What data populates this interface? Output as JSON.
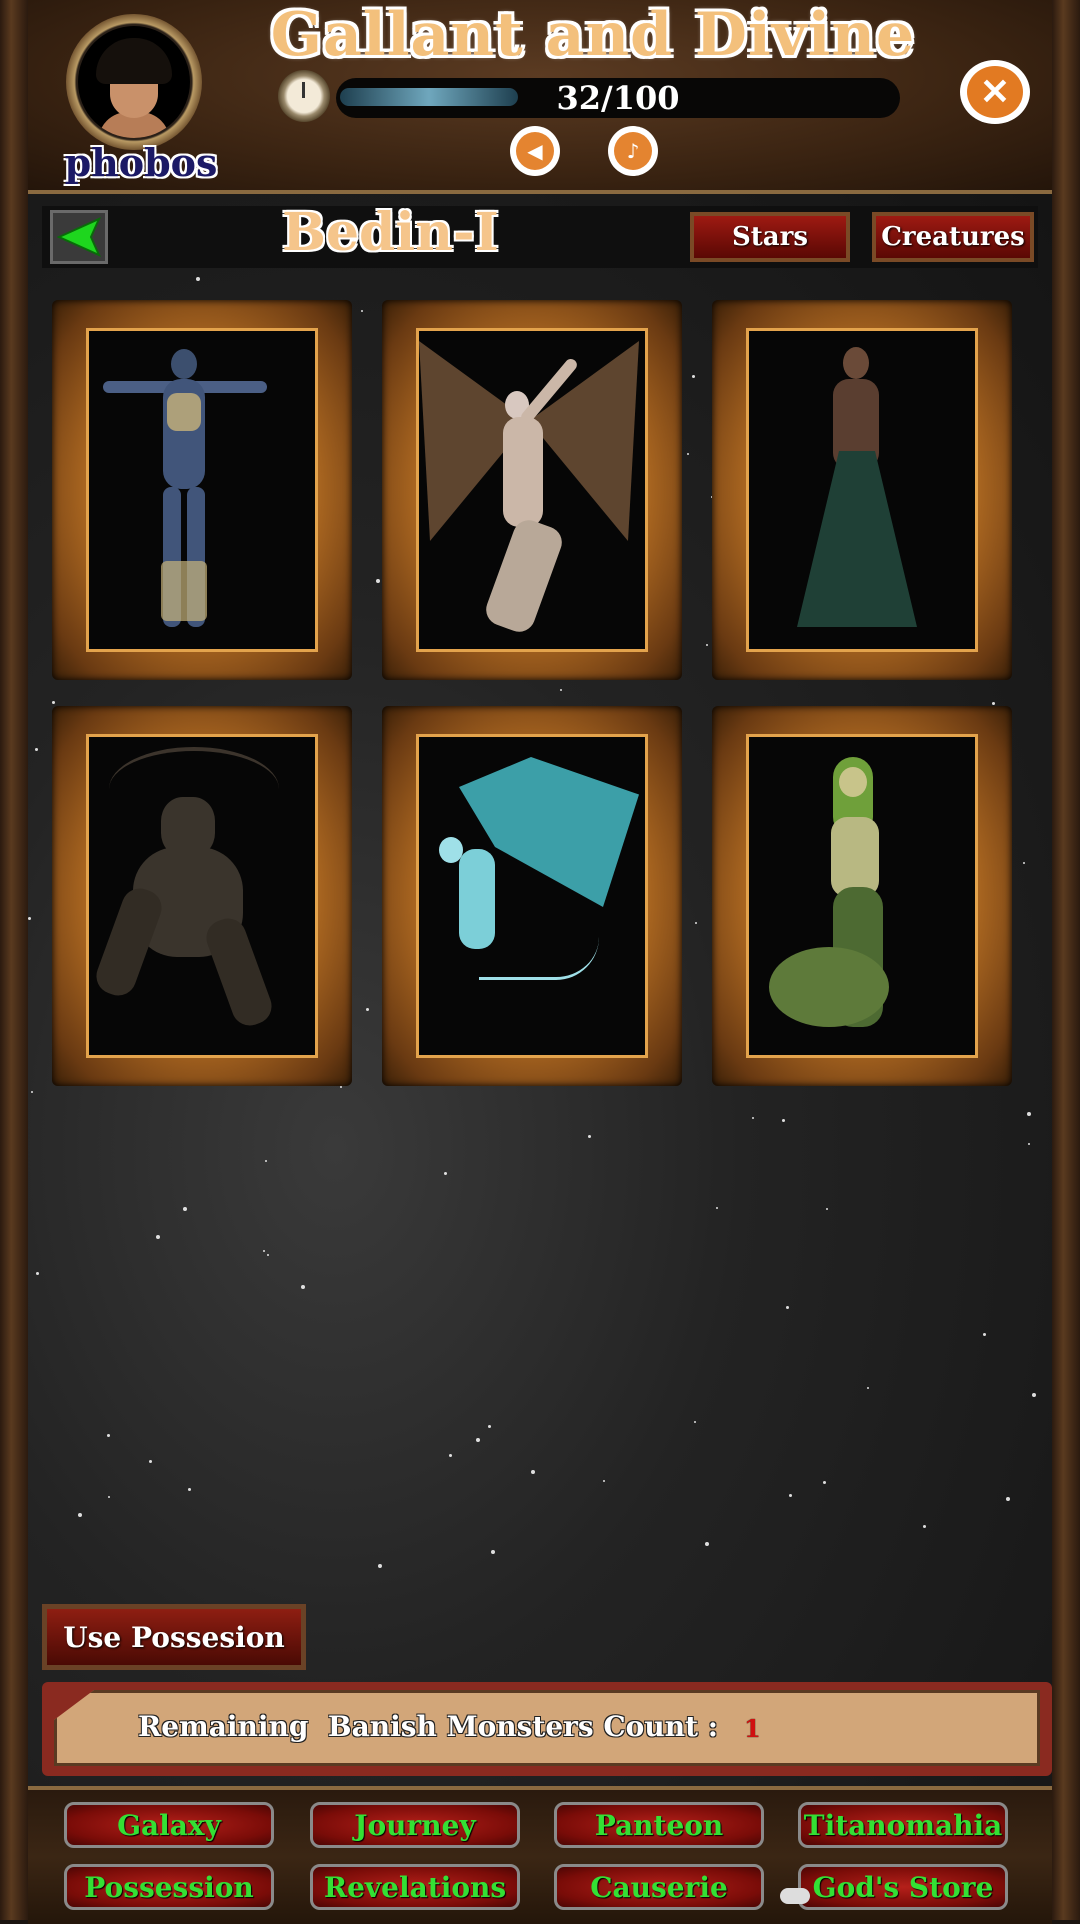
{
  "header": {
    "title": "Gallant and Divine",
    "username": "phobos",
    "energy_text": "32/100",
    "energy_fraction": 0.32
  },
  "toolbar": {
    "location_title": "Bedin-I",
    "stars_label": "Stars",
    "creatures_label": "Creatures"
  },
  "creatures": [
    {
      "name": "blue-elf-warrior"
    },
    {
      "name": "winged-fairy"
    },
    {
      "name": "green-gown-sorceress"
    },
    {
      "name": "wood-treant"
    },
    {
      "name": "teal-winged-spirit"
    },
    {
      "name": "serpent-woman"
    }
  ],
  "actions": {
    "use_possession_label": "Use Possesion",
    "banish_count_label": "Remaining  Banish Monsters Count :",
    "banish_count_value": "1"
  },
  "nav": {
    "row1": [
      "Galaxy",
      "Journey",
      "Panteon",
      "Titanomahia"
    ],
    "row2": [
      "Possession",
      "Revelations",
      "Causerie",
      "God's Store"
    ]
  },
  "icons": {
    "clock": "clock-icon",
    "sound": "speaker-icon",
    "music": "music-note-icon",
    "close": "close-icon",
    "back": "back-arrow-icon",
    "cloud": "cloud-icon"
  },
  "colors": {
    "title": "#f3c07c",
    "nav_text": "#34e034",
    "accent_orange": "#e27a22",
    "panel_tan": "#d2a679"
  }
}
